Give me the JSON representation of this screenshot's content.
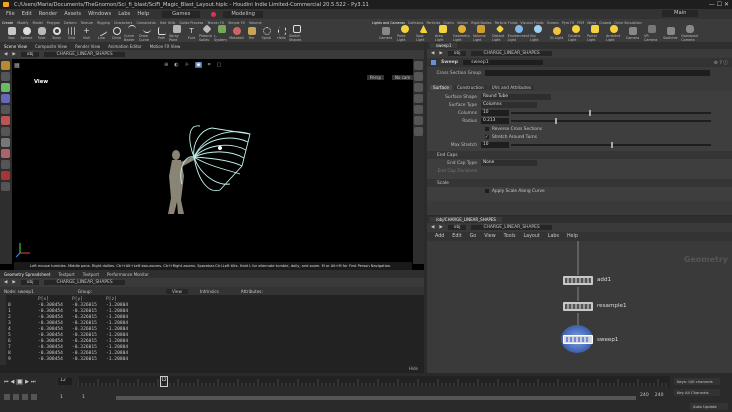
{
  "window": {
    "title": "C:/Users/Maria/Documents/TheGnomon/Sci_fi_blast/SciFi_Magic_Blast_Layout.hiplc - Houdini Indie Limited-Commercial 20.5.522 - Py3.11"
  },
  "menubar": {
    "items": [
      "File",
      "Edit",
      "Render",
      "Assets",
      "Windows",
      "Labs",
      "Help"
    ],
    "desktop": "Games",
    "workspace": "Modeling",
    "right_label": "Main"
  },
  "shelf": {
    "left_tabs": [
      "Create",
      "Modify",
      "Model",
      "Polygon",
      "Deform",
      "Texture",
      "Rigging",
      "Characters",
      "Constraints",
      "Hair Utils",
      "Guide Process",
      "Terrain FX",
      "Simple FX",
      "Volume"
    ],
    "left_tools": [
      "Box",
      "Sphere",
      "Tube",
      "Torus",
      "Grid",
      "Null",
      "Line",
      "Circle",
      "Curve Bezier",
      "Draw Curve",
      "Path",
      "Spray Paint",
      "Font",
      "Platonic Solids",
      "L-System",
      "Metaball",
      "File",
      "Spiral",
      "Helix",
      "Sketch Shapes"
    ],
    "right_tabs": [
      "Lights and Cameras",
      "Collisions",
      "Particles",
      "Grains",
      "Vellum",
      "Rigid Bodies",
      "Particle Fluids",
      "Viscous Fluids",
      "Oceans",
      "Pyro FX",
      "FEM",
      "Wires",
      "Crowds",
      "Drive Simulation"
    ],
    "right_tools": [
      "Camera",
      "Point Light",
      "Spot Light",
      "Area Light",
      "Geometry Light",
      "Volume Light",
      "Distant Light",
      "Environment Light",
      "Sky Light",
      "GI Light",
      "Caustic Light",
      "Portal Light",
      "Ambient Light",
      "Camera",
      "VR Camera",
      "Switcher",
      "Gamepad Camera"
    ]
  },
  "left_panel": {
    "tabs": [
      "Scene View",
      "Composite View",
      "Render View",
      "Animation Editor",
      "Motion FX View"
    ],
    "path": "obj",
    "node": "CHARGE_LINEAR_SHAPES",
    "view_label": "View",
    "persp": "Persp",
    "cam": "No cam",
    "status": "Left mouse tumbles. Middle pans. Right dollies. Ctrl+Alt+Left box-zooms. Ctrl+Right zooms. Spacebar-Ctrl-Left tilts. Hold L for alternate tumble, dolly, and zoom. M or Alt+M for First Person Navigation.",
    "status_right": "Geometry"
  },
  "spreadsheet": {
    "tabs": [
      "Geometry Spreadsheet",
      "Textport",
      "Textport",
      "Performance Monitor"
    ],
    "path": "obj",
    "node": "CHARGE_LINEAR_SHAPES",
    "node_label": "Node: sweep1",
    "group_label": "Group:",
    "view_label": "View",
    "intrinsics_label": "Intrinsics",
    "attributes_label": "Attributes:",
    "columns": [
      "",
      "P[x]",
      "P[y]",
      "P[z]"
    ],
    "rows": [
      [
        "0",
        "-0.308454",
        "-0.326015",
        "-1.20804"
      ],
      [
        "1",
        "-0.308454",
        "-0.326015",
        "-1.20804"
      ],
      [
        "2",
        "-0.308454",
        "-0.326015",
        "-1.20804"
      ],
      [
        "3",
        "-0.308454",
        "-0.326015",
        "-1.20804"
      ],
      [
        "4",
        "-0.308454",
        "-0.326015",
        "-1.20804"
      ],
      [
        "5",
        "-0.308454",
        "-0.326015",
        "-1.20804"
      ],
      [
        "6",
        "-0.308454",
        "-0.326015",
        "-1.20804"
      ],
      [
        "7",
        "-0.308454",
        "-0.326015",
        "-1.20804"
      ],
      [
        "8",
        "-0.308454",
        "-0.326015",
        "-1.20804"
      ],
      [
        "9",
        "-0.308454",
        "-0.326015",
        "-1.20804"
      ],
      [
        "10",
        "-0.308454",
        "-0.326015",
        "-1.20804"
      ]
    ],
    "footer_right": "Hide"
  },
  "params": {
    "tab": "sweep1",
    "path": "obj",
    "node": "CHARGE_LINEAR_SHAPES",
    "node_type": "Sweep",
    "node_name": "sweep1",
    "cross_section_group": "Cross Section Group",
    "subtabs": [
      "Surface",
      "Construction",
      "UVs and Attributes"
    ],
    "surface_shape_label": "Surface Shape",
    "surface_shape": "Round Tube",
    "surface_type_label": "Surface Type",
    "surface_type": "Columns",
    "columns_label": "Columns",
    "columns": "10",
    "radius_label": "Radius",
    "radius": "0.213",
    "reverse_cross": "Reverse Cross Sections",
    "stretch_turns": "Stretch Around Turns",
    "max_stretch_label": "Max Stretch",
    "max_stretch": "10",
    "end_caps_section": "End Caps",
    "end_cap_type_label": "End Cap Type",
    "end_cap_type": "None",
    "end_cap_divs_label": "End Cap Divisions",
    "scale_section": "Scale",
    "apply_scale": "Apply Scale Along Curve"
  },
  "network": {
    "tab": "/obj/CHARGE_LINEAR_SHAPES",
    "path": "obj",
    "node": "CHARGE_LINEAR_SHAPES",
    "menu": [
      "Add",
      "Edit",
      "Go",
      "View",
      "Tools",
      "Layout",
      "Labs",
      "Help"
    ],
    "context_label": "Geometry",
    "nodes": [
      "add1",
      "resample1",
      "sweep1"
    ]
  },
  "timeline": {
    "frame": "12",
    "start": "1",
    "start2": "1",
    "end": "240",
    "end2": "240",
    "right_top": "Keys: 0/0 channels",
    "right_mid": "Key All Channels",
    "right_bot": "Auto Update"
  },
  "colors": {
    "accent": "#f3a326",
    "curve": "#bff3ec",
    "node_sweep": "#6b8fd6",
    "figure": "#8a8474"
  }
}
